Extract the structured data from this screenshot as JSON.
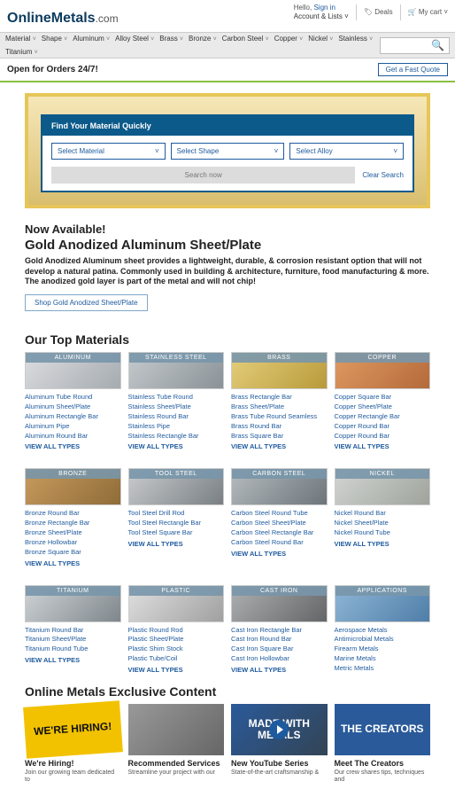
{
  "header": {
    "logo_main": "OnlineMetals",
    "logo_suffix": ".com",
    "hello": "Hello, ",
    "signin": "Sign in",
    "account": "Account & Lists",
    "deals": "Deals",
    "cart": "My cart"
  },
  "nav": [
    "Material",
    "Shape",
    "Aluminum",
    "Alloy Steel",
    "Brass",
    "Bronze",
    "Carbon Steel",
    "Copper",
    "Nickel",
    "Stainless",
    "Titanium"
  ],
  "infobar": {
    "left": "Open for Orders 24/7!",
    "quote": "Get a Fast Quote"
  },
  "hero": {
    "title": "Find Your Material Quickly",
    "select1": "Select Material",
    "select2": "Select Shape",
    "select3": "Select Alloy",
    "search_now": "Search now",
    "clear": "Clear Search"
  },
  "promo": {
    "now": "Now Available!",
    "title": "Gold Anodized Aluminum Sheet/Plate",
    "text": "Gold Anodized Aluminum sheet provides a lightweight, durable, & corrosion resistant option that will not develop a natural patina. Commonly used in building & architecture, furniture, food manufacturing & more. The anodized gold layer is part of the metal and will not chip!",
    "btn": "Shop Gold Anodized Sheet/Plate"
  },
  "top_materials_h": "Our Top Materials",
  "view_all": "VIEW ALL TYPES",
  "materials": [
    {
      "name": "ALUMINUM",
      "cls": "thumb-aluminum",
      "links": [
        "Aluminum Tube Round",
        "Aluminum Sheet/Plate",
        "Aluminum Rectangle Bar",
        "Aluminum Pipe",
        "Aluminum Round Bar"
      ]
    },
    {
      "name": "STAINLESS STEEL",
      "cls": "thumb-stainless",
      "links": [
        "Stainless Tube Round",
        "Stainless Sheet/Plate",
        "Stainless Round Bar",
        "Stainless Pipe",
        "Stainless Rectangle Bar"
      ]
    },
    {
      "name": "BRASS",
      "cls": "thumb-brass",
      "links": [
        "Brass Rectangle Bar",
        "Brass Sheet/Plate",
        "Brass Tube Round Seamless",
        "Brass Round Bar",
        "Brass Square Bar"
      ]
    },
    {
      "name": "COPPER",
      "cls": "thumb-copper",
      "links": [
        "Copper Square Bar",
        "Copper Sheet/Plate",
        "Copper Rectangle Bar",
        "Copper Round Bar",
        "Copper Round Bar"
      ]
    },
    {
      "name": "BRONZE",
      "cls": "thumb-bronze",
      "links": [
        "Bronze Round Bar",
        "Bronze Rectangle Bar",
        "Bronze Sheet/Plate",
        "Bronze Hollowbar",
        "Bronze Square Bar"
      ]
    },
    {
      "name": "TOOL STEEL",
      "cls": "thumb-toolsteel",
      "links": [
        "Tool Steel Drill Rod",
        "Tool Steel Rectangle Bar",
        "Tool Steel Square Bar"
      ]
    },
    {
      "name": "CARBON STEEL",
      "cls": "thumb-carbon",
      "links": [
        "Carbon Steel Round Tube",
        "Carbon Steel Sheet/Plate",
        "Carbon Steel Rectangle Bar",
        "Carbon Steel Round Bar"
      ]
    },
    {
      "name": "NICKEL",
      "cls": "thumb-nickel",
      "links": [
        "Nickel Round Bar",
        "Nickel Sheet/Plate",
        "Nickel Round Tube"
      ]
    },
    {
      "name": "TITANIUM",
      "cls": "thumb-titanium",
      "links": [
        "Titanium Round Bar",
        "Titanium Sheet/Plate",
        "Titanium Round Tube"
      ]
    },
    {
      "name": "PLASTIC",
      "cls": "thumb-plastic",
      "links": [
        "Plastic Round Rod",
        "Plastic Sheet/Plate",
        "Plastic Shim Stock",
        "Plastic Tube/Coil"
      ]
    },
    {
      "name": "CAST IRON",
      "cls": "thumb-castiron",
      "links": [
        "Cast Iron Rectangle Bar",
        "Cast Iron Round Bar",
        "Cast Iron Square Bar",
        "Cast Iron Hollowbar"
      ]
    },
    {
      "name": "APPLICATIONS",
      "cls": "thumb-applications",
      "links": [
        "Aerospace Metals",
        "Antimicrobial Metals",
        "Firearm Metals",
        "Marine Metals",
        "Metric Metals"
      ],
      "no_view_all": true
    }
  ],
  "exclusive_h": "Online Metals Exclusive Content",
  "exclusive": [
    {
      "thumb": "WE'RE HIRING!",
      "thumb_cls": "yellow",
      "title": "We're Hiring!",
      "desc": "Join our growing team dedicated to"
    },
    {
      "thumb": "",
      "thumb_cls": "grey",
      "title": "Recommended Services",
      "desc": "Streamline your project with our"
    },
    {
      "thumb": "MADE WITH METALS",
      "thumb_cls": "blue1",
      "title": "New YouTube Series",
      "desc": "State-of-the-art craftsmanship &",
      "play": true
    },
    {
      "thumb": "THE CREATORS",
      "thumb_cls": "blue2",
      "title": "Meet The Creators",
      "desc": "Our crew shares tips, techniques and"
    }
  ]
}
